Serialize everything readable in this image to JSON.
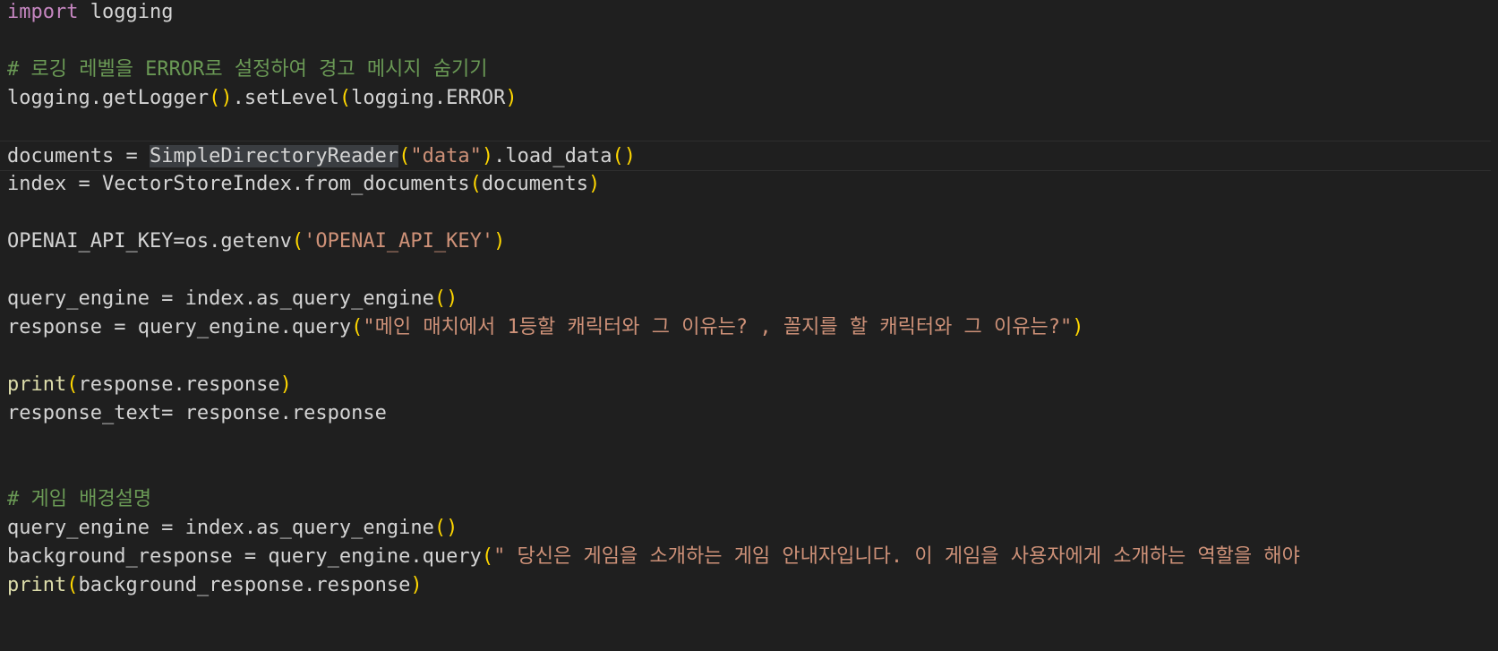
{
  "editor": {
    "theme_colors": {
      "background": "#1f1f1f",
      "default": "#d4d4d4",
      "keyword": "#c586c0",
      "comment": "#6a9955",
      "function": "#dcdcaa",
      "bracket": "#ffd700",
      "string": "#ce9178",
      "highlight": "#3a3d41"
    },
    "current_line": 5,
    "lines": [
      [
        {
          "t": "import",
          "c": "kw"
        },
        {
          "t": " logging",
          "c": "id"
        }
      ],
      [],
      [
        {
          "t": "# 로깅 레벨을 ERROR로 설정하여 경고 메시지 숨기기",
          "c": "cm"
        }
      ],
      [
        {
          "t": "logging.getLogger",
          "c": "id"
        },
        {
          "t": "()",
          "c": "br"
        },
        {
          "t": ".setLevel",
          "c": "id"
        },
        {
          "t": "(",
          "c": "br"
        },
        {
          "t": "logging.ERROR",
          "c": "id"
        },
        {
          "t": ")",
          "c": "br"
        }
      ],
      [],
      [
        {
          "t": "documents = ",
          "c": "id"
        },
        {
          "t": "SimpleDirectoryReader",
          "c": "id hl"
        },
        {
          "t": "(",
          "c": "br"
        },
        {
          "t": "\"data\"",
          "c": "str"
        },
        {
          "t": ")",
          "c": "br"
        },
        {
          "t": ".load_data",
          "c": "id"
        },
        {
          "t": "()",
          "c": "br"
        }
      ],
      [
        {
          "t": "index = VectorStoreIndex.from_documents",
          "c": "id"
        },
        {
          "t": "(",
          "c": "br"
        },
        {
          "t": "documents",
          "c": "id"
        },
        {
          "t": ")",
          "c": "br"
        }
      ],
      [],
      [
        {
          "t": "OPENAI_API_KEY=os.getenv",
          "c": "id"
        },
        {
          "t": "(",
          "c": "br"
        },
        {
          "t": "'OPENAI_API_KEY'",
          "c": "str"
        },
        {
          "t": ")",
          "c": "br"
        }
      ],
      [],
      [
        {
          "t": "query_engine = index.as_query_engine",
          "c": "id"
        },
        {
          "t": "()",
          "c": "br"
        }
      ],
      [
        {
          "t": "response = query_engine.query",
          "c": "id"
        },
        {
          "t": "(",
          "c": "br"
        },
        {
          "t": "\"메인 매치에서 1등할 캐릭터와 그 이유는? , 꼴지를 할 캐릭터와 그 이유는?\"",
          "c": "str"
        },
        {
          "t": ")",
          "c": "br"
        }
      ],
      [],
      [
        {
          "t": "print",
          "c": "fn"
        },
        {
          "t": "(",
          "c": "br"
        },
        {
          "t": "response.response",
          "c": "id"
        },
        {
          "t": ")",
          "c": "br"
        }
      ],
      [
        {
          "t": "response_text= response.response",
          "c": "id"
        }
      ],
      [],
      [],
      [
        {
          "t": "# 게임 배경설명",
          "c": "cm"
        }
      ],
      [
        {
          "t": "query_engine = index.as_query_engine",
          "c": "id"
        },
        {
          "t": "()",
          "c": "br"
        }
      ],
      [
        {
          "t": "background_response = query_engine.query",
          "c": "id"
        },
        {
          "t": "(",
          "c": "br"
        },
        {
          "t": "\" 당신은 게임을 소개하는 게임 안내자입니다. 이 게임을 사용자에게 소개하는 역할을 해야",
          "c": "str"
        }
      ],
      [
        {
          "t": "print",
          "c": "fn"
        },
        {
          "t": "(",
          "c": "br"
        },
        {
          "t": "background_response.response",
          "c": "id"
        },
        {
          "t": ")",
          "c": "br"
        }
      ]
    ]
  }
}
